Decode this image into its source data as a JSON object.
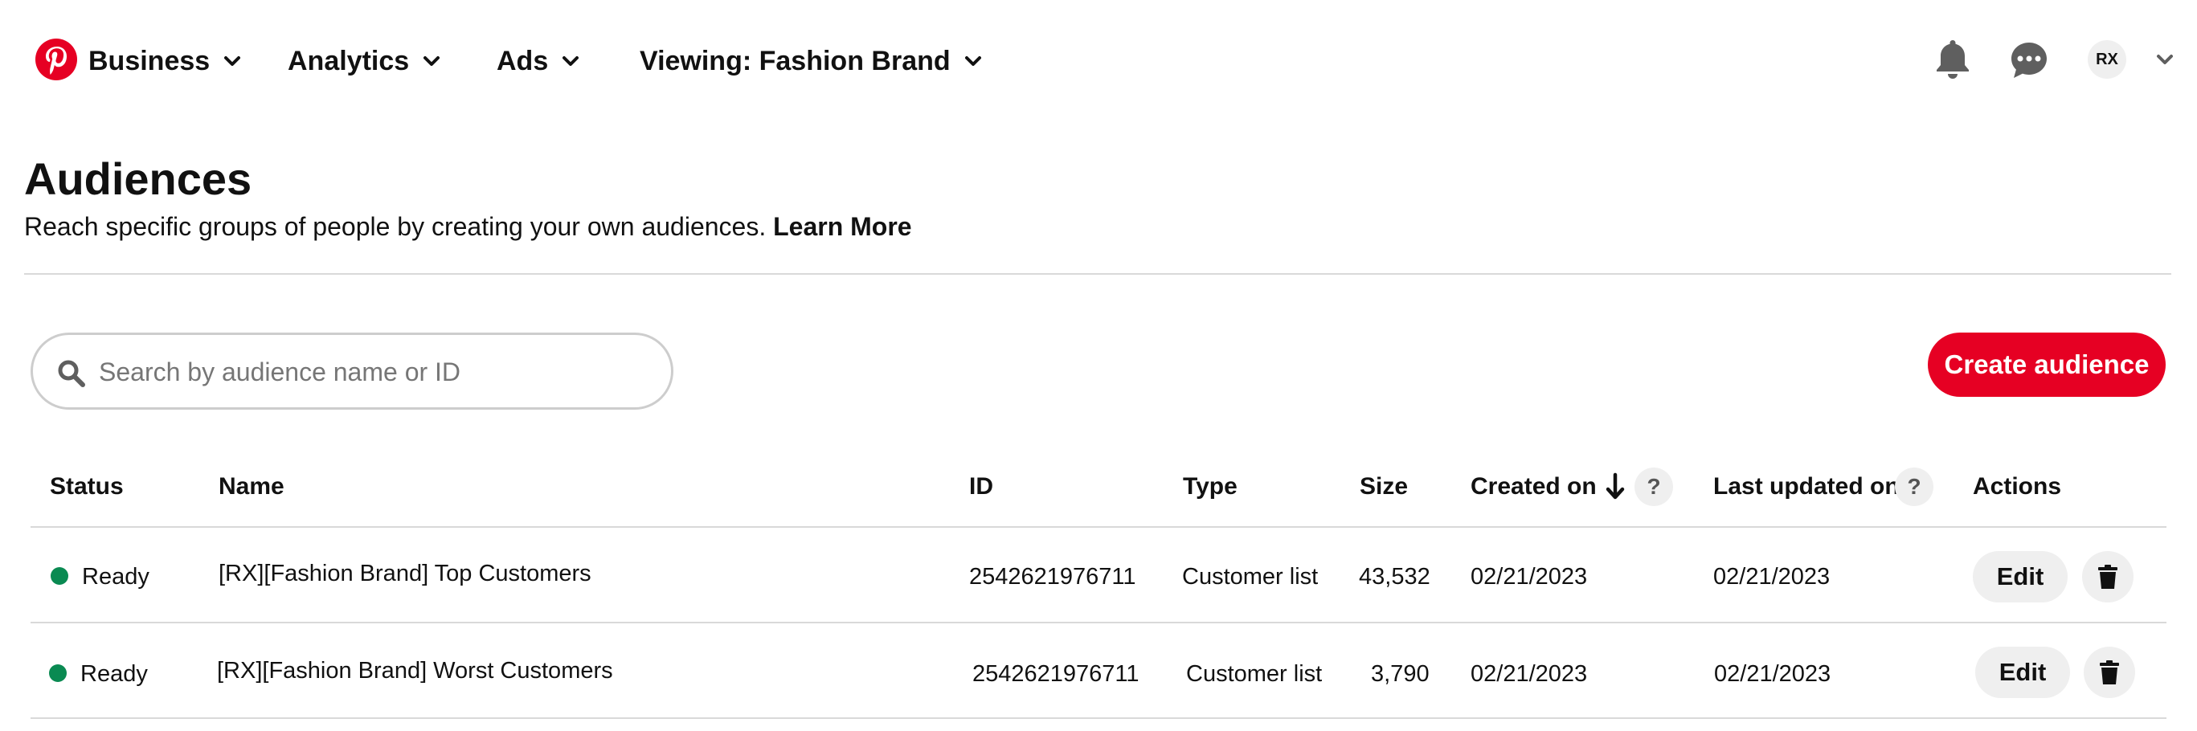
{
  "nav": {
    "business_label": "Business",
    "analytics_label": "Analytics",
    "ads_label": "Ads",
    "viewing_label": "Viewing: Fashion Brand",
    "avatar_initials": "RX",
    "icons": [
      "pinterest-logo",
      "chevron-down-icon",
      "bell-icon",
      "message-icon",
      "chevron-down-icon"
    ]
  },
  "header": {
    "title": "Audiences",
    "subtitle": "Reach specific groups of people by creating your own audiences.",
    "learn_more": "Learn More"
  },
  "search": {
    "placeholder": "Search by audience name or ID",
    "value": ""
  },
  "create_button": "Create audience",
  "table": {
    "headers": {
      "status": "Status",
      "name": "Name",
      "id": "ID",
      "type": "Type",
      "size": "Size",
      "created_on": "Created on",
      "last_updated_on": "Last updated on",
      "actions": "Actions"
    },
    "help_glyph": "?",
    "rows": [
      {
        "status": "Ready",
        "name": "[RX][Fashion Brand] Top Customers",
        "id": "2542621976711",
        "type": "Customer list",
        "size": "43,532",
        "created_on": "02/21/2023",
        "last_updated_on": "02/21/2023",
        "edit_label": "Edit"
      },
      {
        "status": "Ready",
        "name": "[RX][Fashion Brand] Worst Customers",
        "id": "2542621976711",
        "type": "Customer list",
        "size": "3,790",
        "created_on": "02/21/2023",
        "last_updated_on": "02/21/2023",
        "edit_label": "Edit"
      }
    ]
  },
  "colors": {
    "brand_red": "#e60023",
    "status_ready": "#0a8a52",
    "button_gray": "#efefef",
    "divider": "#d9d9d9"
  }
}
